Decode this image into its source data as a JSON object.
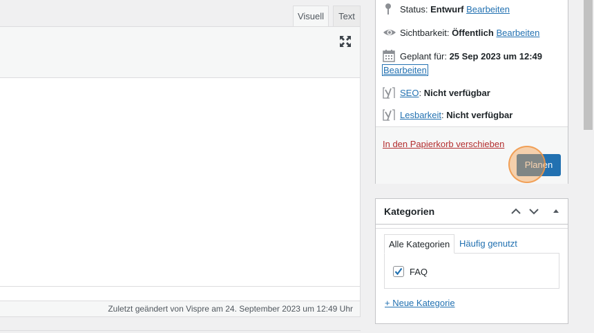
{
  "editor": {
    "tabs": {
      "visual": "Visuell",
      "text": "Text"
    },
    "last_modified": "Zuletzt geändert von Vispre am 24. September 2023 um 12:49 Uhr"
  },
  "publish": {
    "status_label": "Status:",
    "status_value": "Entwurf",
    "visibility_label": "Sichtbarkeit:",
    "visibility_value": "Öffentlich",
    "scheduled_label": "Geplant für:",
    "scheduled_value": "25 Sep 2023 um 12:49",
    "edit_link": "Bearbeiten",
    "seo_link": "SEO",
    "seo_value": "Nicht verfügbar",
    "readability_link": "Lesbarkeit",
    "readability_value": "Nicht verfügbar",
    "trash_link": "In den Papierkorb verschieben",
    "plan_button": "Planen"
  },
  "categories": {
    "title": "Kategorien",
    "tabs": {
      "all": "Alle Kategorien",
      "popular": "Häufig genutzt"
    },
    "items": [
      {
        "label": "FAQ",
        "checked": true
      }
    ],
    "add_new": "+ Neue Kategorie"
  },
  "colors": {
    "accent": "#2271b1",
    "trash": "#b32d2e",
    "highlight": "#f5a050"
  },
  "icons": [
    "fullscreen-icon",
    "pin-icon",
    "eye-icon",
    "calendar-icon",
    "yoast-icon",
    "chevron-up-icon",
    "chevron-down-icon",
    "triangle-up-icon"
  ]
}
